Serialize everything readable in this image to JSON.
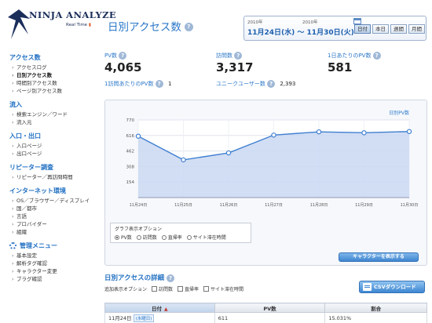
{
  "header": {
    "logo_text": "NINJA ANALYZE",
    "logo_sub": "Real Time",
    "title": "日別アクセス数",
    "date_from_year": "2010年",
    "date_to_year": "2010年",
    "date_range": "11月24日(水) 〜 11月30日(火)",
    "range_buttons": [
      "日付",
      "本日",
      "週間",
      "月間"
    ]
  },
  "sidebar": {
    "groups": [
      {
        "heading": "アクセス数",
        "items": [
          "アクセスログ",
          "日別アクセス数",
          "時間別アクセス数",
          "ページ別アクセス数"
        ]
      },
      {
        "heading": "流入",
        "items": [
          "検索エンジン／ワード",
          "流入元"
        ]
      },
      {
        "heading": "入口・出口",
        "items": [
          "入口ページ",
          "出口ページ"
        ]
      },
      {
        "heading": "リピーター調査",
        "items": [
          "リピーター／再訪問時間"
        ]
      },
      {
        "heading": "インターネット環境",
        "items": [
          "OS／ブラウザー／ディスプレイ",
          "国／都市",
          "言語",
          "プロバイダー",
          "組織"
        ]
      },
      {
        "heading": "管理メニュー",
        "items": [
          "基本設定",
          "解析タグ確認",
          "キャラクター変更",
          "ブラグ確認"
        ]
      }
    ]
  },
  "stats": {
    "pv": {
      "label": "PV数",
      "value": "4,065"
    },
    "visits": {
      "label": "訪問数",
      "value": "3,317"
    },
    "daily_pv": {
      "label": "1日あたりのPV数",
      "value": "581"
    },
    "pv_per_visit": {
      "label": "1訪問あたりのPV数",
      "value": "1"
    },
    "unique_users": {
      "label": "ユニークユーザー数",
      "value": "2,393"
    }
  },
  "chart_data": {
    "type": "area",
    "title": "",
    "legend": "日別PV数",
    "legend_position": "top-right",
    "x": [
      "11月24日",
      "11月25日",
      "11月26日",
      "11月27日",
      "11月28日",
      "11月29日",
      "11月30日"
    ],
    "series": [
      {
        "name": "日別PV数",
        "values": [
          609,
          374,
          443,
          620,
          652,
          643,
          655
        ]
      }
    ],
    "y_ticks": [
      154,
      308,
      462,
      616,
      770
    ],
    "ylim": [
      0,
      770
    ],
    "grid": true,
    "colors": {
      "line": "#3f7fd0",
      "fill": "#cad8f2",
      "point_fill": "#ffffff"
    }
  },
  "graph_options": {
    "title": "グラフ表示オプション",
    "options": [
      "PV数",
      "訪問数",
      "直帰率",
      "サイト滞在時間"
    ],
    "selected": "PV数"
  },
  "character_button": "キャラクターを表示する",
  "detail": {
    "title": "日別アクセスの詳細",
    "extra_label": "追加表示オプション",
    "extra_options": [
      "訪問数",
      "直帰率",
      "サイト滞在時間"
    ],
    "csv_button": "CSVダウンロード",
    "columns": [
      "日付",
      "PV数",
      "割合"
    ],
    "rows": [
      {
        "date": "11月24日",
        "dow": "(水曜日)",
        "pv": "611",
        "share": "15.031%"
      }
    ]
  }
}
